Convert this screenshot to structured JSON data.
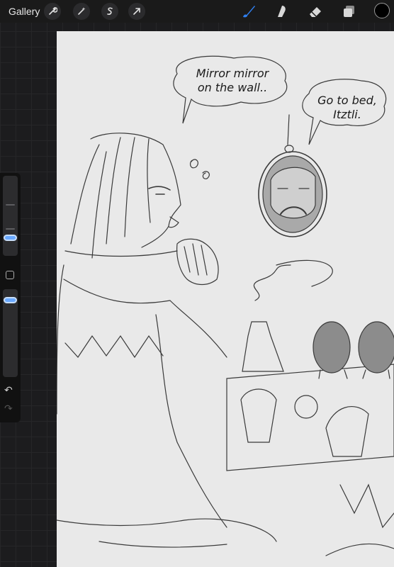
{
  "topbar": {
    "gallery_label": "Gallery",
    "actions": [
      "wrench-icon",
      "magic-wand-icon",
      "selection-s-icon",
      "arrow-transform-icon"
    ],
    "tools": [
      "brush-icon",
      "smudge-icon",
      "eraser-icon",
      "layers-icon"
    ],
    "active_tool": "brush-icon",
    "brush_color": "#2f7ff0",
    "current_color": "#000000"
  },
  "sidebar": {
    "brush_size_level": 0.55,
    "opacity_level": 0.93
  },
  "canvas": {
    "bubble1": {
      "line1": "Mirror mirror",
      "line2": "on the wall.."
    },
    "bubble2": {
      "line1": "Go to bed,",
      "line2": "Itztli."
    }
  }
}
